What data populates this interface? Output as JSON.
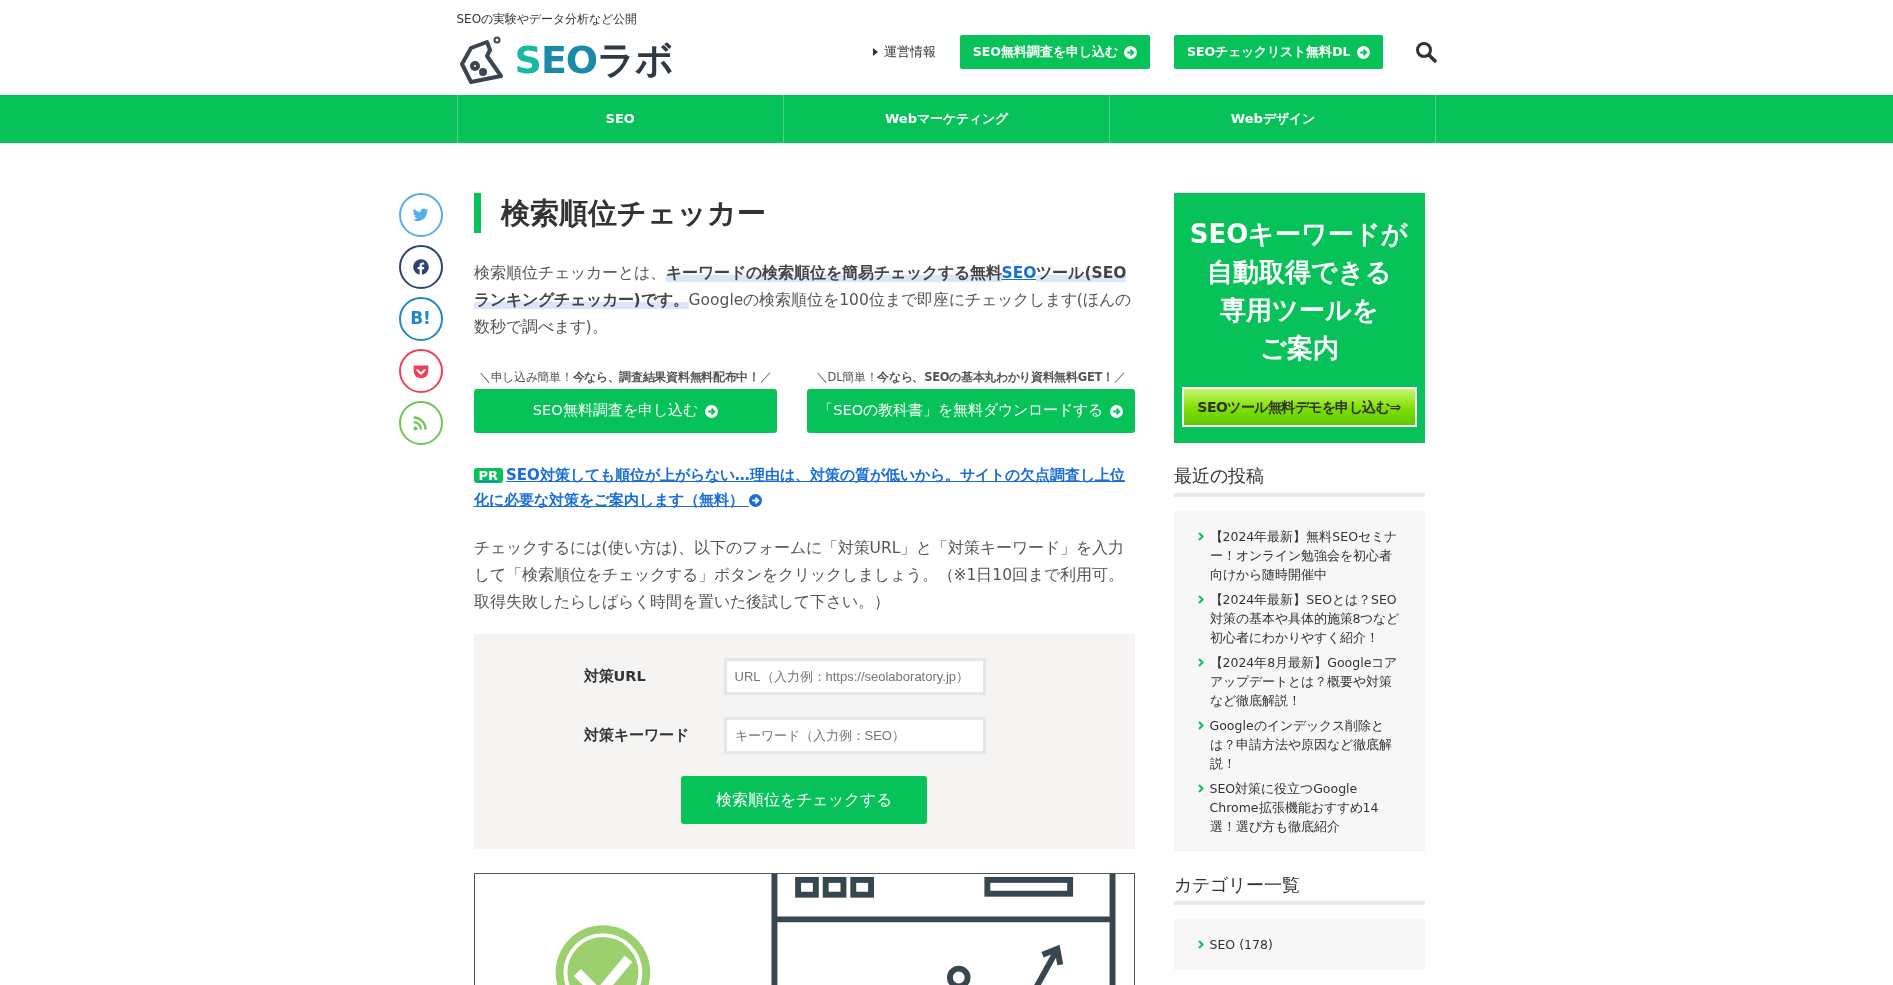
{
  "header": {
    "tagline": "SEOの実験やデータ分析など公開",
    "logo": [
      {
        "text": "S",
        "color": "#17b9a3"
      },
      {
        "text": "EO",
        "color": "#1a8aa8"
      },
      {
        "text": "ラボ",
        "color": "#2f3a44"
      }
    ],
    "about_link": "運営情報",
    "buttons": [
      "SEO無料調査を申し込む",
      "SEOチェックリスト無料DL"
    ]
  },
  "nav": [
    {
      "label": "SEO"
    },
    {
      "label": "Webマーケティング"
    },
    {
      "label": "Webデザイン"
    }
  ],
  "share": [
    {
      "kind": "twitter"
    },
    {
      "kind": "facebook"
    },
    {
      "kind": "hatena",
      "text": "B!"
    },
    {
      "kind": "pocket"
    },
    {
      "kind": "rss"
    }
  ],
  "article": {
    "title": "検索順位チェッカー",
    "intro": [
      {
        "kind": "text",
        "text": "検索順位チェッカーとは、"
      },
      {
        "kind": "bold",
        "text": "キーワードの検索順位を簡易チェックする無料"
      },
      {
        "kind": "link",
        "text": "SEO"
      },
      {
        "kind": "bold",
        "text": "ツール(SEOランキングチェッカー)です。"
      },
      {
        "kind": "text",
        "text": "Googleの検索順位を100位まで即座にチェックします(ほんの数秒で調べます)。"
      }
    ],
    "cta": [
      {
        "caption": "＼申し込み簡単！**今なら、調査結果資料無料配布中！**／",
        "button": "SEO無料調査を申し込む"
      },
      {
        "caption": "＼DL簡単！**今なら、SEOの基本丸わかり資料無料GET！**／",
        "button": "「SEOの教科書」を無料ダウンロードする"
      }
    ],
    "pr": {
      "badge": "PR",
      "link": "SEO対策しても順位が上がらない…理由は、対策の質が低いから。サイトの欠点調査し上位化に必要な対策をご案内します（無料）"
    },
    "usage": "チェックするには(使い方は)、以下のフォームに「対策URL」と「対策キーワード」を入力して「検索順位をチェックする」ボタンをクリックしましょう。（※1日10回まで利用可。取得失敗したらしばらく時間を置いた後試して下さい。）",
    "form": {
      "fields": [
        {
          "label": "対策URL",
          "placeholder": "URL（入力例：https://seolaboratory.jp）"
        },
        {
          "label": "対策キーワード",
          "placeholder": "キーワード（入力例：SEO）"
        }
      ],
      "submit": "検索順位をチェックする"
    }
  },
  "sidebar": {
    "banner": {
      "lines": [
        "SEOキーワードが",
        "自動取得できる",
        "専用ツールを",
        "ご案内"
      ],
      "button": "SEOツール無料デモを申し込む⇒"
    },
    "recent": {
      "heading": "最近の投稿",
      "items": [
        {
          "title": "【2024年最新】無料SEOセミナー！オンライン勉強会を初心者向けから随時開催中"
        },
        {
          "title": "【2024年最新】SEOとは？SEO対策の基本や具体的施策8つなど初心者にわかりやすく紹介！"
        },
        {
          "title": "【2024年8月最新】Googleコアアップデートとは？概要や対策など徹底解説！"
        },
        {
          "title": "Googleのインデックス削除とは？申請方法や原因など徹底解説！"
        },
        {
          "title": "SEO対策に役立つGoogle Chrome拡張機能おすすめ14選！選び方も徹底紹介"
        }
      ]
    },
    "categories": {
      "heading": "カテゴリー一覧",
      "items": [
        {
          "title": "SEO (178)"
        }
      ]
    }
  }
}
